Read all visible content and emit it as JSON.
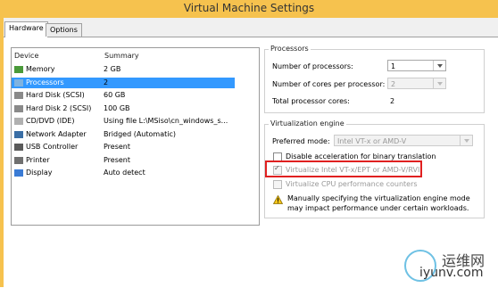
{
  "window": {
    "title": "Virtual Machine Settings"
  },
  "tabs": [
    {
      "label": "Hardware",
      "active": true
    },
    {
      "label": "Options",
      "active": false
    }
  ],
  "device_list": {
    "headers": {
      "device": "Device",
      "summary": "Summary"
    },
    "rows": [
      {
        "device": "Memory",
        "summary": "2 GB",
        "icon": "memory-icon",
        "selected": false
      },
      {
        "device": "Processors",
        "summary": "2",
        "icon": "processor-icon",
        "selected": true
      },
      {
        "device": "Hard Disk (SCSI)",
        "summary": "60 GB",
        "icon": "hard-disk-icon",
        "selected": false
      },
      {
        "device": "Hard Disk 2 (SCSI)",
        "summary": "100 GB",
        "icon": "hard-disk-icon",
        "selected": false
      },
      {
        "device": "CD/DVD (IDE)",
        "summary": "Using file L:\\MSiso\\cn_windows_s...",
        "icon": "cd-dvd-icon",
        "selected": false
      },
      {
        "device": "Network Adapter",
        "summary": "Bridged (Automatic)",
        "icon": "network-icon",
        "selected": false
      },
      {
        "device": "USB Controller",
        "summary": "Present",
        "icon": "usb-icon",
        "selected": false
      },
      {
        "device": "Printer",
        "summary": "Present",
        "icon": "printer-icon",
        "selected": false
      },
      {
        "device": "Display",
        "summary": "Auto detect",
        "icon": "display-icon",
        "selected": false
      }
    ]
  },
  "processors": {
    "group_label": "Processors",
    "num_processors_label": "Number of processors:",
    "num_processors_value": "1",
    "cores_label": "Number of cores per processor:",
    "cores_value": "2",
    "total_label": "Total processor cores:",
    "total_value": "2"
  },
  "virtualization": {
    "group_label": "Virtualization engine",
    "mode_label": "Preferred mode:",
    "mode_value": "Intel VT-x or AMD-V",
    "disable_accel_label": "Disable acceleration for binary translation",
    "virtualize_label": "Virtualize Intel VT-x/EPT or AMD-V/RVI",
    "virtualize_checked": true,
    "cpu_counters_label": "Virtualize CPU performance counters",
    "warning_line1": "Manually specifying the virtualization engine mode",
    "warning_line2": "may impact performance under certain workloads."
  },
  "watermark": {
    "cn": "运维网",
    "url": "iyunv.com"
  },
  "colors": {
    "title_bar": "#f6c24e",
    "selection": "#3399ff",
    "highlight_box": "#e02020"
  }
}
